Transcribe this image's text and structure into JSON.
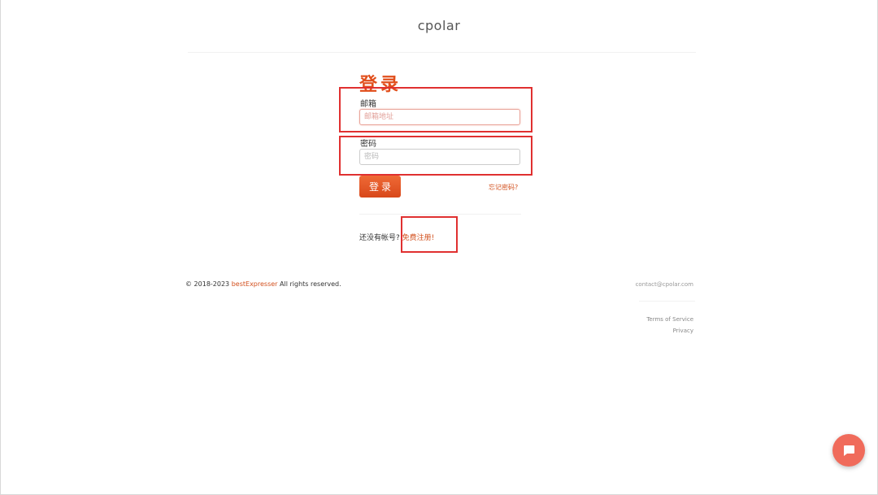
{
  "header": {
    "brand": "cpolar"
  },
  "login": {
    "title": "登录",
    "email_label": "邮箱",
    "email_placeholder": "邮箱地址",
    "email_value": "",
    "password_label": "密码",
    "password_placeholder": "密码",
    "password_value": "",
    "submit_label": "登录",
    "forgot_link": "忘记密码?"
  },
  "signup": {
    "prompt": "还没有帐号?",
    "link": "免费注册!"
  },
  "footer": {
    "copyright_prefix": "© 2018-2023",
    "company": "bestExpresser",
    "copyright_suffix": "All rights reserved.",
    "contact": "contact@cpolar.com",
    "terms": "Terms of Service",
    "privacy": "Privacy"
  },
  "colors": {
    "accent": "#e14f1c",
    "annotation": "#e03030",
    "chat": "#f06b5b"
  },
  "icons": {
    "chat": "chat-bubble-icon"
  }
}
